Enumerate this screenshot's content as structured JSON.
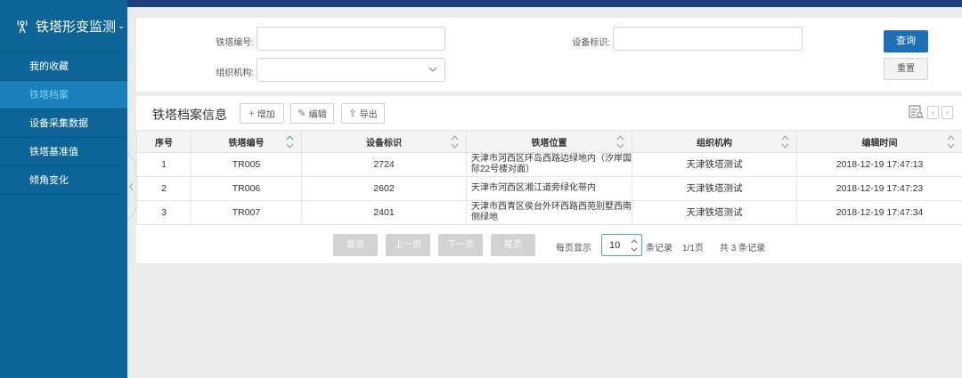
{
  "sidebar": {
    "title": "铁塔形变监测",
    "items": [
      {
        "label": "我的收藏"
      },
      {
        "label": "铁塔档案"
      },
      {
        "label": "设备采集数据"
      },
      {
        "label": "铁塔基准值"
      },
      {
        "label": "倾角变化"
      }
    ],
    "active_index": 1
  },
  "search": {
    "tower_label": "铁塔编号:",
    "tower_value": "",
    "device_label": "设备标识:",
    "device_value": "",
    "org_label": "组织机构:",
    "org_value": "",
    "query_button": "查询",
    "reset_button": "重置"
  },
  "panel": {
    "title": "铁塔档案信息",
    "add_button": "增加",
    "edit_button": "编辑",
    "export_button": "导出"
  },
  "table": {
    "columns": [
      "序号",
      "铁塔编号",
      "设备标识",
      "铁塔位置",
      "组织机构",
      "编辑时间"
    ],
    "rows": [
      {
        "seq": "1",
        "tower": "TR005",
        "device": "2724",
        "location": "天津市河西区环岛西路边绿地内（汐岸国际22号楼对面）",
        "org": "天津铁塔测试",
        "time": "2018-12-19 17:47:13"
      },
      {
        "seq": "2",
        "tower": "TR006",
        "device": "2602",
        "location": "天津市河西区湘江道旁绿化带内",
        "org": "天津铁塔测试",
        "time": "2018-12-19 17:47:23"
      },
      {
        "seq": "3",
        "tower": "TR007",
        "device": "2401",
        "location": "天津市西青区侯台外环西路西苑别墅西南侧绿地",
        "org": "天津铁塔测试",
        "time": "2018-12-19 17:47:34"
      }
    ]
  },
  "pager": {
    "first": "首页",
    "prev": "上一页",
    "next": "下一页",
    "last": "尾页",
    "per_page_label": "每页显示",
    "per_page_value": "10",
    "records_unit": "条记录",
    "page_info": "1/1页",
    "total_info": "共 3 条记录"
  },
  "colors": {
    "sidebar_bg": "#0d6496",
    "sidebar_active": "#1a80b9",
    "topbar": "#1f3f7a",
    "primary_button": "#1e6fb6"
  }
}
